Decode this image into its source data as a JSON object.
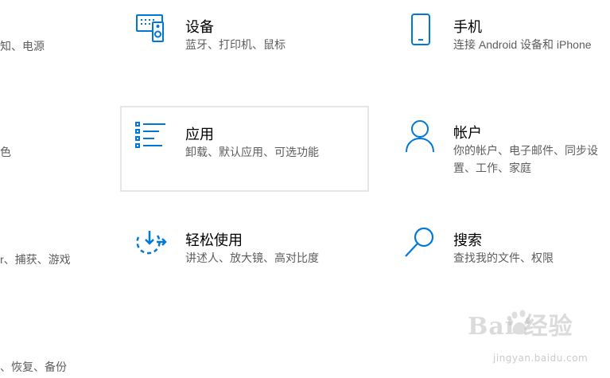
{
  "left_fragments": [
    "知、电源",
    "色",
    "r、捕获、游戏",
    "、恢复、备份"
  ],
  "tiles": [
    {
      "title": "设备",
      "desc": "蓝牙、打印机、鼠标",
      "icon": "devices-icon"
    },
    {
      "title": "手机",
      "desc": "连接 Android 设备和 iPhone",
      "icon": "phone-icon"
    },
    {
      "title": "应用",
      "desc": "卸载、默认应用、可选功能",
      "icon": "apps-list-icon"
    },
    {
      "title": "帐户",
      "desc": "你的帐户、电子邮件、同步设",
      "desc2": "置、工作、家庭",
      "icon": "person-icon"
    },
    {
      "title": "轻松使用",
      "desc": "讲述人、放大镜、高对比度",
      "icon": "ease-of-access-icon"
    },
    {
      "title": "搜索",
      "desc": "查找我的文件、权限",
      "icon": "search-icon"
    }
  ],
  "watermark": {
    "logo": "Bai 经验",
    "sub": "jingyan.baidu.com"
  },
  "colors": {
    "accent": "#0078d7",
    "desc": "#5d5d5d",
    "hover_border": "#e6e6e6"
  }
}
